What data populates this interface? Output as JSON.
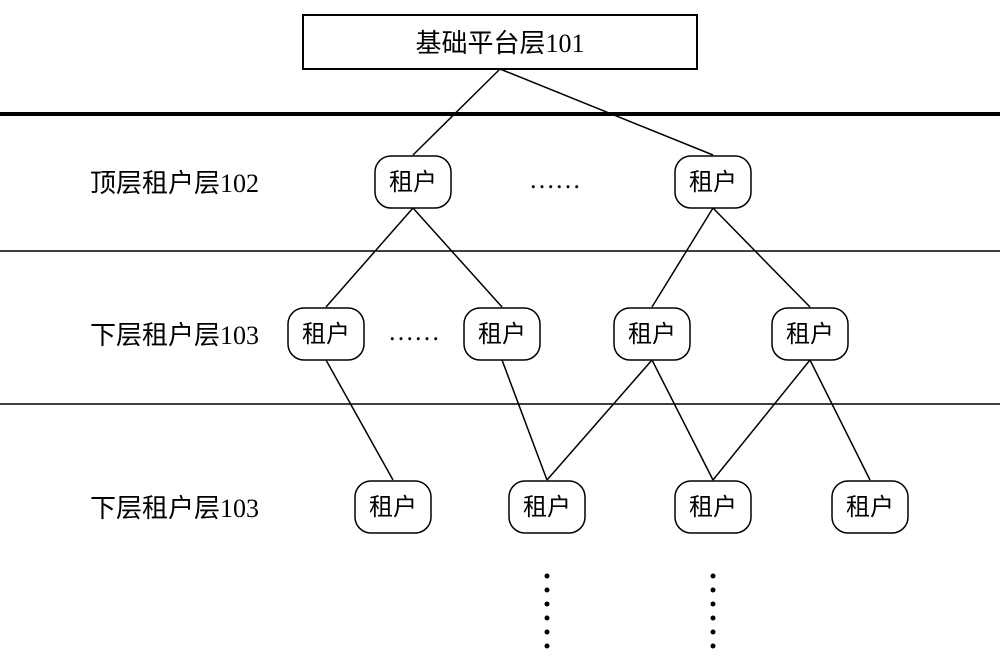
{
  "root": {
    "label": "基础平台层101"
  },
  "layers": [
    {
      "label": "顶层租户层102"
    },
    {
      "label": "下层租户层103"
    },
    {
      "label": "下层租户层103"
    }
  ],
  "nodeLabel": "租户",
  "hdots": "……",
  "hdots2": "……"
}
